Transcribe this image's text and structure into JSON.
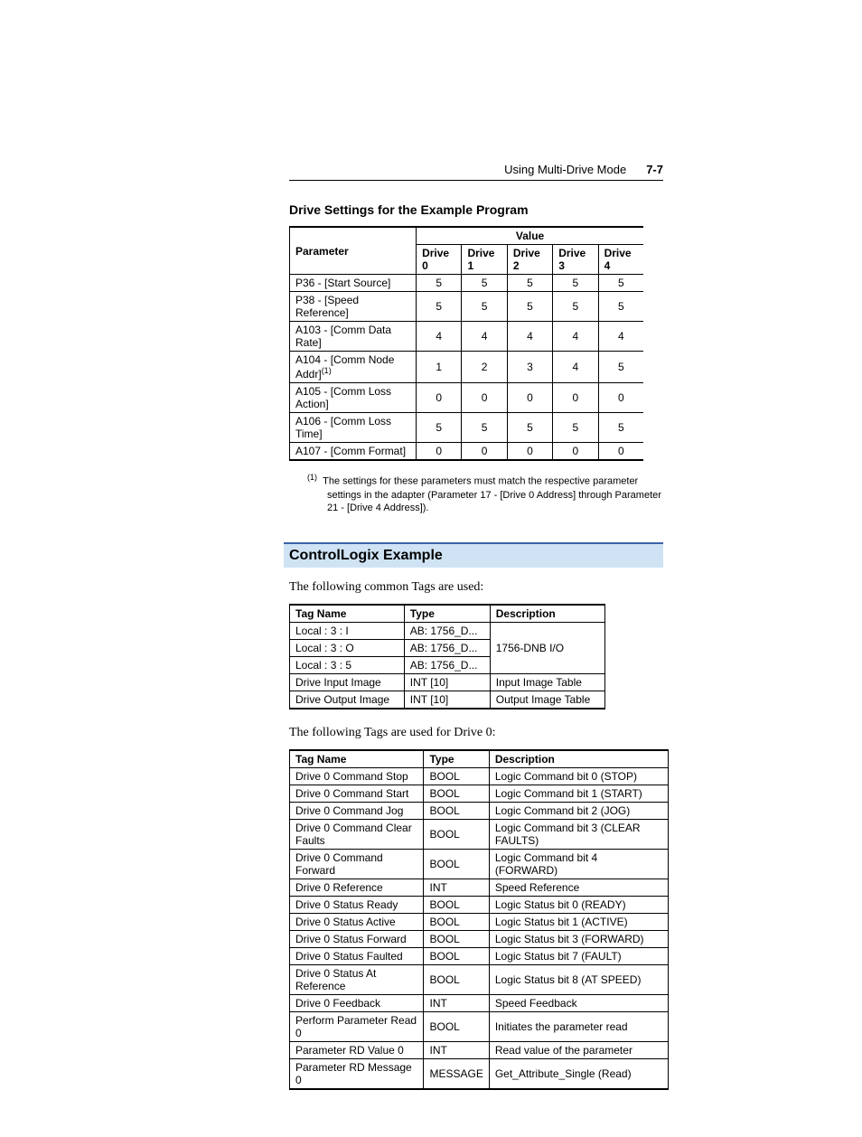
{
  "header": {
    "title": "Using Multi-Drive Mode",
    "page": "7-7"
  },
  "sections": {
    "drive_settings_title": "Drive Settings for the Example Program",
    "controllogix_title": "ControlLogix Example",
    "common_tags_intro": "The following common Tags are used:",
    "drive0_tags_intro": "The following Tags are used for Drive 0:"
  },
  "drive_settings_table": {
    "param_header": "Parameter",
    "value_header": "Value",
    "drive_headers": [
      "Drive 0",
      "Drive 1",
      "Drive 2",
      "Drive 3",
      "Drive 4"
    ],
    "rows": [
      {
        "param": "P36 - [Start Source]",
        "fn": "",
        "values": [
          "5",
          "5",
          "5",
          "5",
          "5"
        ]
      },
      {
        "param": "P38 - [Speed Reference]",
        "fn": "",
        "values": [
          "5",
          "5",
          "5",
          "5",
          "5"
        ]
      },
      {
        "param": "A103 - [Comm Data Rate]",
        "fn": "",
        "values": [
          "4",
          "4",
          "4",
          "4",
          "4"
        ]
      },
      {
        "param": "A104 - [Comm Node Addr]",
        "fn": "(1)",
        "values": [
          "1",
          "2",
          "3",
          "4",
          "5"
        ]
      },
      {
        "param": "A105 - [Comm Loss Action]",
        "fn": "",
        "values": [
          "0",
          "0",
          "0",
          "0",
          "0"
        ]
      },
      {
        "param": "A106 - [Comm Loss Time]",
        "fn": "",
        "values": [
          "5",
          "5",
          "5",
          "5",
          "5"
        ]
      },
      {
        "param": "A107 - [Comm Format]",
        "fn": "",
        "values": [
          "0",
          "0",
          "0",
          "0",
          "0"
        ]
      }
    ]
  },
  "footnote": {
    "marker": "(1)",
    "text": "The settings for these parameters must match the respective parameter settings in the adapter (Parameter 17 - [Drive 0 Address] through Parameter 21 - [Drive 4 Address])."
  },
  "common_tags_table": {
    "headers": [
      "Tag Name",
      "Type",
      "Description"
    ],
    "rows": [
      {
        "name": "Local : 3 : I",
        "type": "AB: 1756_D...",
        "desc": ""
      },
      {
        "name": "Local : 3 : O",
        "type": "AB: 1756_D...",
        "desc": "1756-DNB I/O"
      },
      {
        "name": "Local : 3 : 5",
        "type": "AB: 1756_D...",
        "desc": ""
      },
      {
        "name": "Drive Input Image",
        "type": "INT [10]",
        "desc": "Input Image Table"
      },
      {
        "name": "Drive Output Image",
        "type": "INT [10]",
        "desc": "Output Image Table"
      }
    ],
    "merged_desc_span": 3
  },
  "drive0_tags_table": {
    "headers": [
      "Tag Name",
      "Type",
      "Description"
    ],
    "rows": [
      {
        "name": "Drive 0 Command Stop",
        "type": "BOOL",
        "desc": "Logic Command bit 0 (STOP)"
      },
      {
        "name": "Drive 0 Command Start",
        "type": "BOOL",
        "desc": "Logic Command bit 1 (START)"
      },
      {
        "name": "Drive 0 Command Jog",
        "type": "BOOL",
        "desc": "Logic Command bit 2 (JOG)"
      },
      {
        "name": "Drive 0 Command Clear Faults",
        "type": "BOOL",
        "desc": "Logic Command bit 3 (CLEAR FAULTS)"
      },
      {
        "name": "Drive 0 Command Forward",
        "type": "BOOL",
        "desc": "Logic Command bit 4 (FORWARD)"
      },
      {
        "name": "Drive 0 Reference",
        "type": "INT",
        "desc": "Speed Reference"
      },
      {
        "name": "Drive 0 Status Ready",
        "type": "BOOL",
        "desc": "Logic Status bit 0 (READY)"
      },
      {
        "name": "Drive 0 Status Active",
        "type": "BOOL",
        "desc": "Logic Status bit 1 (ACTIVE)"
      },
      {
        "name": "Drive 0 Status Forward",
        "type": "BOOL",
        "desc": "Logic Status bit 3 (FORWARD)"
      },
      {
        "name": "Drive 0 Status Faulted",
        "type": "BOOL",
        "desc": "Logic Status bit 7 (FAULT)"
      },
      {
        "name": "Drive 0 Status At Reference",
        "type": "BOOL",
        "desc": "Logic Status bit 8 (AT SPEED)"
      },
      {
        "name": "Drive 0 Feedback",
        "type": "INT",
        "desc": "Speed Feedback"
      },
      {
        "name": "Perform Parameter Read 0",
        "type": "BOOL",
        "desc": "Initiates the parameter read"
      },
      {
        "name": "Parameter RD Value 0",
        "type": "INT",
        "desc": "Read value of the parameter"
      },
      {
        "name": "Parameter RD Message 0",
        "type": "MESSAGE",
        "desc": "Get_Attribute_Single (Read)"
      }
    ]
  }
}
